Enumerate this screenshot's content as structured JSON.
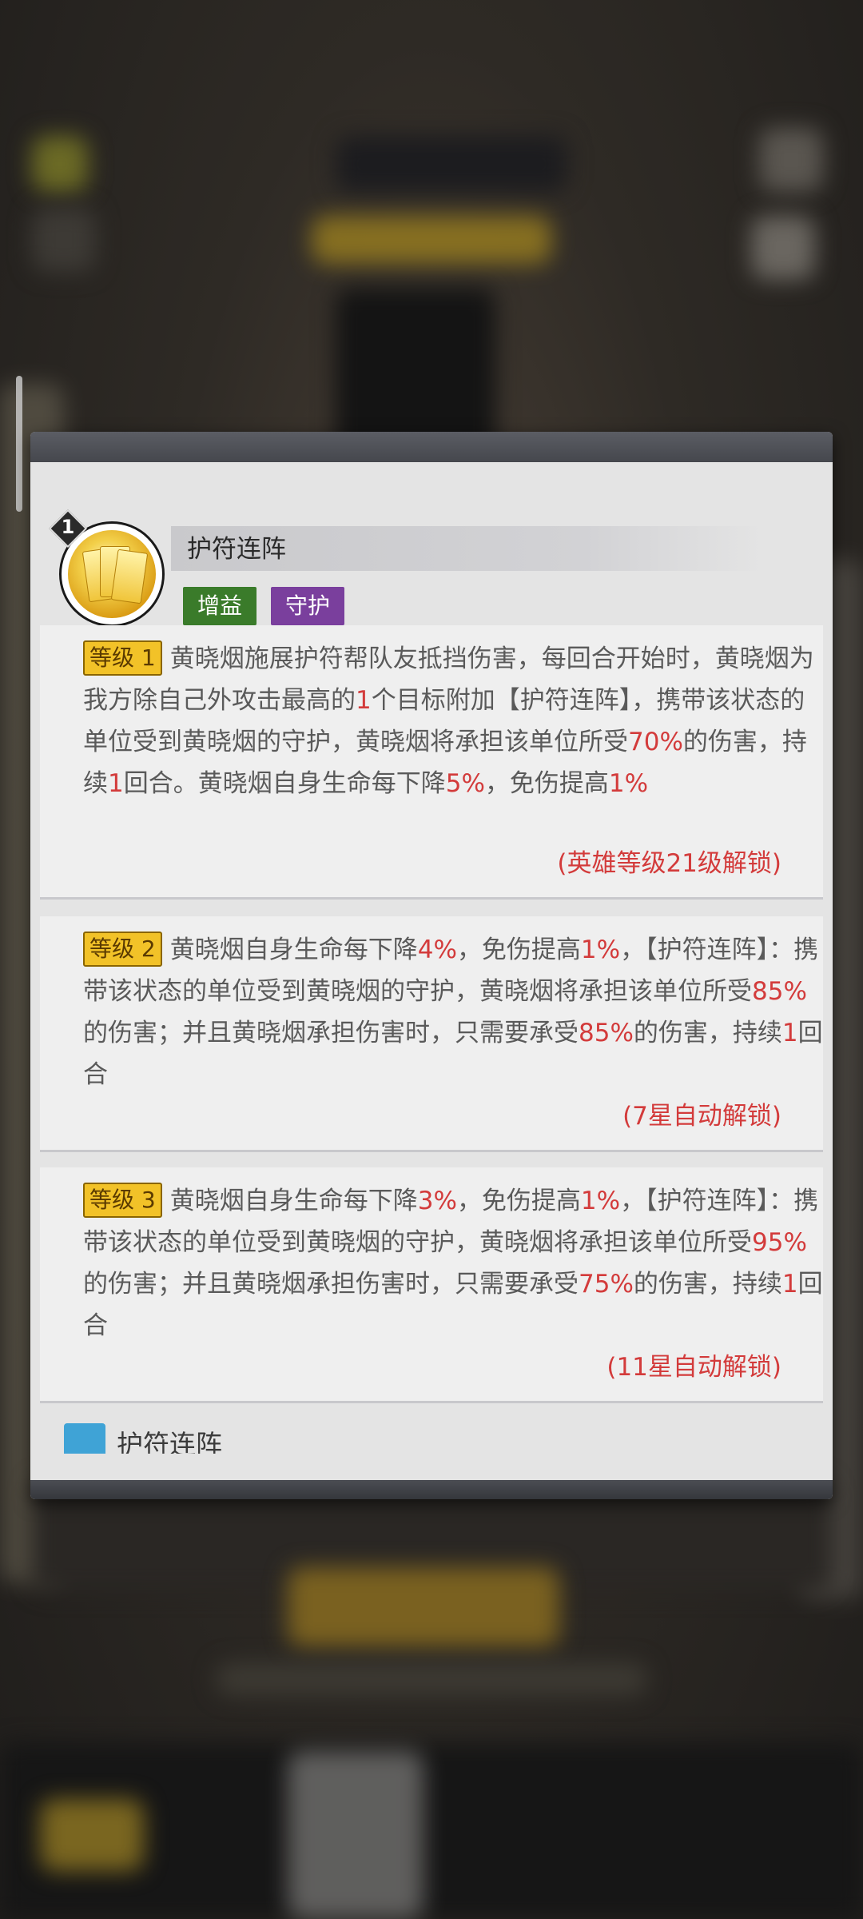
{
  "skill": {
    "level_number": "1",
    "name": "护符连阵",
    "tags": [
      "增益",
      "守护"
    ]
  },
  "levels": [
    {
      "badge": "等级 1",
      "segments": [
        "黄晓烟施展护符帮队友抵挡伤害，每回合开始时，黄晓烟为我方除自己外攻击最高的",
        "1",
        "个目标附加【护符连阵】，携带该状态的单位受到黄晓烟的守护，黄晓烟将承担该单位所受",
        "70%",
        "的伤害，持续",
        "1",
        "回合。黄晓烟自身生命每下降",
        "5%",
        "，免伤提高",
        "1%"
      ],
      "unlock": "(英雄等级21级解锁)"
    },
    {
      "badge": "等级 2",
      "segments": [
        "黄晓烟自身生命每下降",
        "4%",
        "，免伤提高",
        "1%",
        "，【护符连阵】：携带该状态的单位受到黄晓烟的守护，黄晓烟将承担该单位所受",
        "85%",
        "的伤害；并且黄晓烟承担伤害时，只需要承受",
        "85%",
        "的伤害，持续",
        "1",
        "回合"
      ],
      "unlock": "(7星自动解锁)"
    },
    {
      "badge": "等级 3",
      "segments": [
        "黄晓烟自身生命每下降",
        "3%",
        "，免伤提高",
        "1%",
        "，【护符连阵】：携带该状态的单位受到黄晓烟的守护，黄晓烟将承担该单位所受",
        "95%",
        "的伤害；并且黄晓烟承担伤害时，只需要承受",
        "75%",
        "的伤害，持续",
        "1",
        "回合"
      ],
      "unlock": "(11星自动解锁)"
    }
  ],
  "next_peek": {
    "label": "护符连阵"
  },
  "colors": {
    "highlight": "#d33b3b",
    "badge": "#f2c228",
    "tag_buff": "#3a7b2a",
    "tag_guard": "#7a3f9d"
  }
}
